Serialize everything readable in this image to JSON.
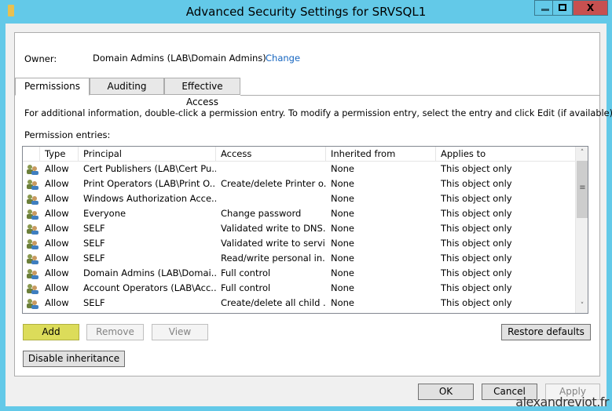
{
  "window": {
    "title": "Advanced Security Settings for SRVSQL1",
    "minimize": "–",
    "maximize": "□",
    "close": "X"
  },
  "owner": {
    "label": "Owner:",
    "value": "Domain Admins (LAB\\Domain Admins)",
    "change": "Change"
  },
  "tabs": [
    {
      "label": "Permissions",
      "active": true
    },
    {
      "label": "Auditing"
    },
    {
      "label": "Effective Access"
    }
  ],
  "info": "For additional information, double-click a permission entry. To modify a permission entry, select the entry and click Edit (if available).",
  "entries_label": "Permission entries:",
  "columns": [
    "Type",
    "Principal",
    "Access",
    "Inherited from",
    "Applies to"
  ],
  "rows": [
    [
      "Allow",
      "Cert Publishers (LAB\\Cert Pu...",
      "",
      "None",
      "This object only"
    ],
    [
      "Allow",
      "Print Operators (LAB\\Print O...",
      "Create/delete Printer o...",
      "None",
      "This object only"
    ],
    [
      "Allow",
      "Windows Authorization Acce...",
      "",
      "None",
      "This object only"
    ],
    [
      "Allow",
      "Everyone",
      "Change password",
      "None",
      "This object only"
    ],
    [
      "Allow",
      "SELF",
      "Validated write to DNS...",
      "None",
      "This object only"
    ],
    [
      "Allow",
      "SELF",
      "Validated write to servi...",
      "None",
      "This object only"
    ],
    [
      "Allow",
      "SELF",
      "Read/write personal in...",
      "None",
      "This object only"
    ],
    [
      "Allow",
      "Domain Admins (LAB\\Domai...",
      "Full control",
      "None",
      "This object only"
    ],
    [
      "Allow",
      "Account Operators (LAB\\Acc...",
      "Full control",
      "None",
      "This object only"
    ],
    [
      "Allow",
      "SELF",
      "Create/delete all child ...",
      "None",
      "This object only"
    ]
  ],
  "buttons": {
    "add": "Add",
    "remove": "Remove",
    "view": "View",
    "restore": "Restore defaults",
    "disable_inheritance": "Disable inheritance",
    "ok": "OK",
    "cancel": "Cancel",
    "apply": "Apply"
  },
  "watermark": "alexandreviot.fr",
  "colors": {
    "title_bar": "#63c9e8",
    "close": "#c75050",
    "highlight_add": "#dcdc5a",
    "link": "#1565c0"
  }
}
